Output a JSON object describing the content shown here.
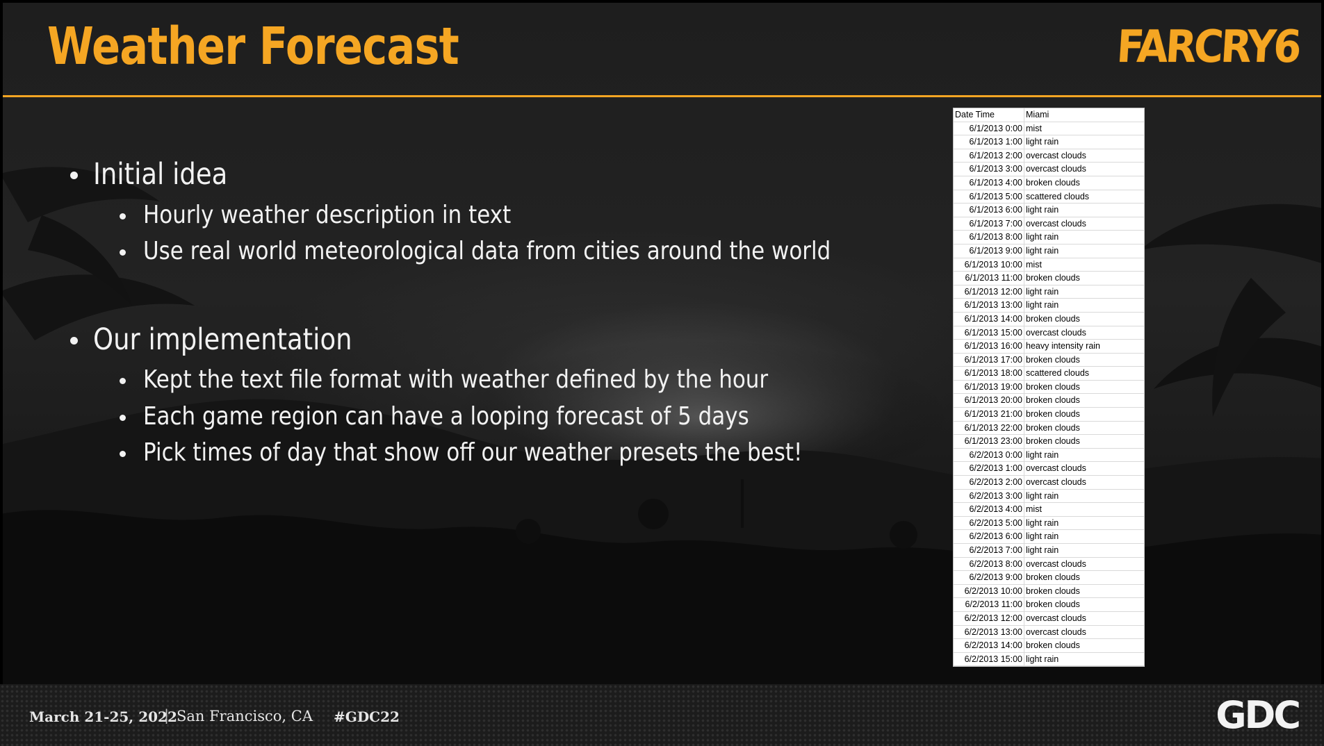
{
  "slide": {
    "title": "Weather Forecast",
    "logo_text": "FARCRY6",
    "bullets": [
      {
        "text": "Initial idea",
        "children": [
          "Hourly weather description in text",
          "Use real world meteorological data from cities around the world"
        ]
      },
      {
        "text": "Our implementation",
        "children": [
          "Kept the text file format with weather defined by the hour",
          "Each game region can have a looping forecast of 5 days",
          "Pick times of day that show off our weather presets the best!"
        ]
      }
    ]
  },
  "sheet": {
    "headers": [
      "Date Time",
      "Miami"
    ],
    "rows": [
      [
        "6/1/2013 0:00",
        "mist"
      ],
      [
        "6/1/2013 1:00",
        "light rain"
      ],
      [
        "6/1/2013 2:00",
        "overcast clouds"
      ],
      [
        "6/1/2013 3:00",
        "overcast clouds"
      ],
      [
        "6/1/2013 4:00",
        "broken clouds"
      ],
      [
        "6/1/2013 5:00",
        "scattered clouds"
      ],
      [
        "6/1/2013 6:00",
        "light rain"
      ],
      [
        "6/1/2013 7:00",
        "overcast clouds"
      ],
      [
        "6/1/2013 8:00",
        "light rain"
      ],
      [
        "6/1/2013 9:00",
        "light rain"
      ],
      [
        "6/1/2013 10:00",
        "mist"
      ],
      [
        "6/1/2013 11:00",
        "broken clouds"
      ],
      [
        "6/1/2013 12:00",
        "light rain"
      ],
      [
        "6/1/2013 13:00",
        "light rain"
      ],
      [
        "6/1/2013 14:00",
        "broken clouds"
      ],
      [
        "6/1/2013 15:00",
        "overcast clouds"
      ],
      [
        "6/1/2013 16:00",
        "heavy intensity rain"
      ],
      [
        "6/1/2013 17:00",
        "broken clouds"
      ],
      [
        "6/1/2013 18:00",
        "scattered clouds"
      ],
      [
        "6/1/2013 19:00",
        "broken clouds"
      ],
      [
        "6/1/2013 20:00",
        "broken clouds"
      ],
      [
        "6/1/2013 21:00",
        "broken clouds"
      ],
      [
        "6/1/2013 22:00",
        "broken clouds"
      ],
      [
        "6/1/2013 23:00",
        "broken clouds"
      ],
      [
        "6/2/2013 0:00",
        "light rain"
      ],
      [
        "6/2/2013 1:00",
        "overcast clouds"
      ],
      [
        "6/2/2013 2:00",
        "overcast clouds"
      ],
      [
        "6/2/2013 3:00",
        "light rain"
      ],
      [
        "6/2/2013 4:00",
        "mist"
      ],
      [
        "6/2/2013 5:00",
        "light rain"
      ],
      [
        "6/2/2013 6:00",
        "light rain"
      ],
      [
        "6/2/2013 7:00",
        "light rain"
      ],
      [
        "6/2/2013 8:00",
        "overcast clouds"
      ],
      [
        "6/2/2013 9:00",
        "broken clouds"
      ],
      [
        "6/2/2013 10:00",
        "broken clouds"
      ],
      [
        "6/2/2013 11:00",
        "broken clouds"
      ],
      [
        "6/2/2013 12:00",
        "overcast clouds"
      ],
      [
        "6/2/2013 13:00",
        "overcast clouds"
      ],
      [
        "6/2/2013 14:00",
        "broken clouds"
      ],
      [
        "6/2/2013 15:00",
        "light rain"
      ]
    ]
  },
  "footer": {
    "dates": "March 21-25, 2022",
    "separator": "|",
    "city": "San Francisco, CA",
    "hashtag": "#GDC22",
    "gdc_logo_text": "GDC"
  },
  "colors": {
    "accent": "#f5a623",
    "text": "#f2f2f2",
    "background": "#1e1e1e",
    "footer": "#1c1c1c"
  }
}
